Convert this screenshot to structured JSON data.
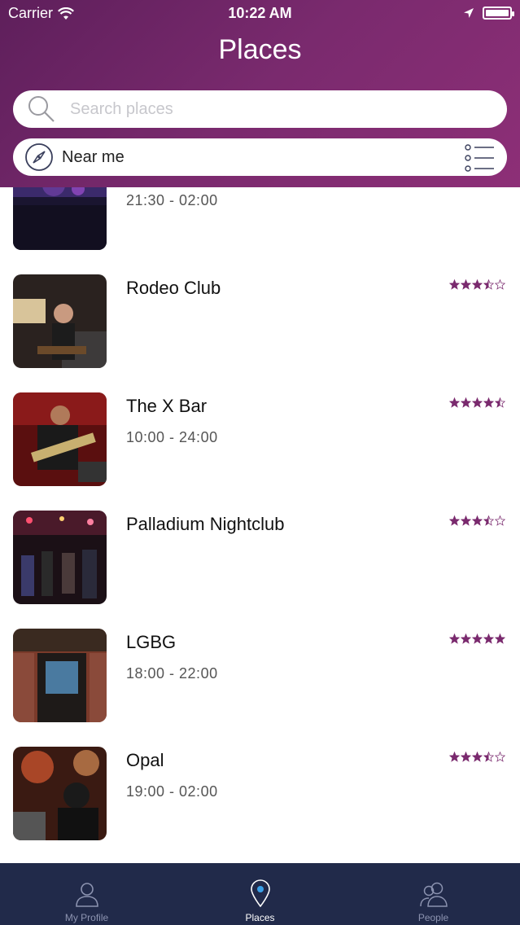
{
  "status_bar": {
    "carrier": "Carrier",
    "time": "10:22 AM"
  },
  "header": {
    "title": "Places"
  },
  "search": {
    "placeholder": "Search places",
    "value": ""
  },
  "filter": {
    "label": "Near me"
  },
  "colors": {
    "accent": "#7a2a6e",
    "tabbar": "#212a4a",
    "star": "#7a2a6e"
  },
  "places": [
    {
      "name": "",
      "hours": "21:30 - 02:00",
      "rating": null,
      "thumb": "concert-crowd-dark"
    },
    {
      "name": "Rodeo Club",
      "hours": "",
      "rating": 3.5,
      "thumb": "guitarist-on-stage"
    },
    {
      "name": "The X Bar",
      "hours": "10:00 - 24:00",
      "rating": 4.5,
      "thumb": "bassist-red-light"
    },
    {
      "name": "Palladium Nightclub",
      "hours": "",
      "rating": 3.5,
      "thumb": "nightclub-crowd"
    },
    {
      "name": "LGBG",
      "hours": "18:00 - 22:00",
      "rating": 5,
      "thumb": "bar-entrance"
    },
    {
      "name": "Opal",
      "hours": "19:00 - 02:00",
      "rating": 3.5,
      "thumb": "dj-party"
    }
  ],
  "tabs": [
    {
      "label": "My Profile",
      "icon": "person-icon"
    },
    {
      "label": "Places",
      "icon": "location-pin-icon",
      "active": true
    },
    {
      "label": "People",
      "icon": "people-icon"
    }
  ]
}
